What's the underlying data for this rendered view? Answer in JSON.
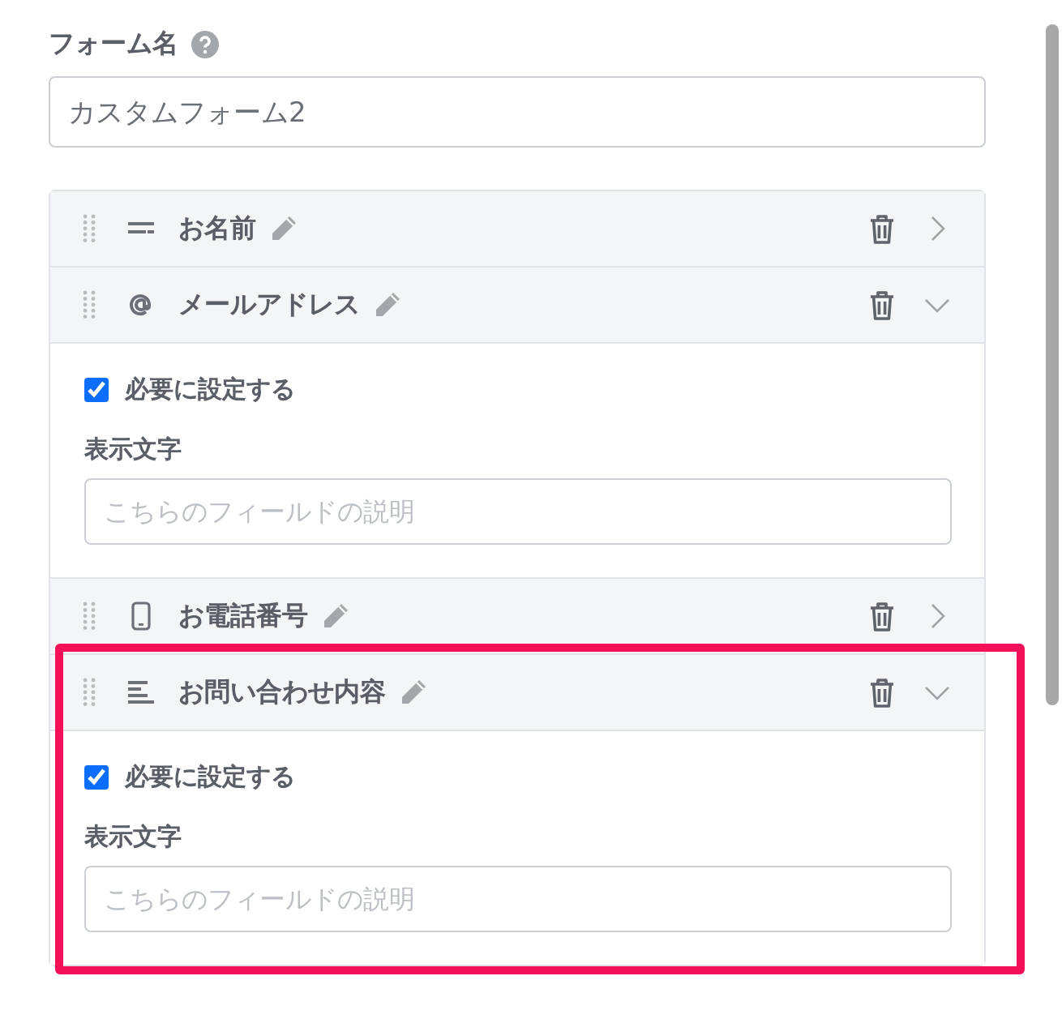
{
  "form_name": {
    "label": "フォーム名",
    "value": "カスタムフォーム2"
  },
  "fields": [
    {
      "kind": "name",
      "label": "お名前",
      "expanded": false,
      "highlighted": false
    },
    {
      "kind": "email",
      "label": "メールアドレス",
      "expanded": true,
      "highlighted": false,
      "required_label": "必要に設定する",
      "required": true,
      "display_label": "表示文字",
      "placeholder": "こちらのフィールドの説明"
    },
    {
      "kind": "phone",
      "label": "お電話番号",
      "expanded": false,
      "highlighted": false
    },
    {
      "kind": "textarea",
      "label": "お問い合わせ内容",
      "expanded": true,
      "highlighted": true,
      "required_label": "必要に設定する",
      "required": true,
      "display_label": "表示文字",
      "placeholder": "こちらのフィールドの説明"
    }
  ]
}
